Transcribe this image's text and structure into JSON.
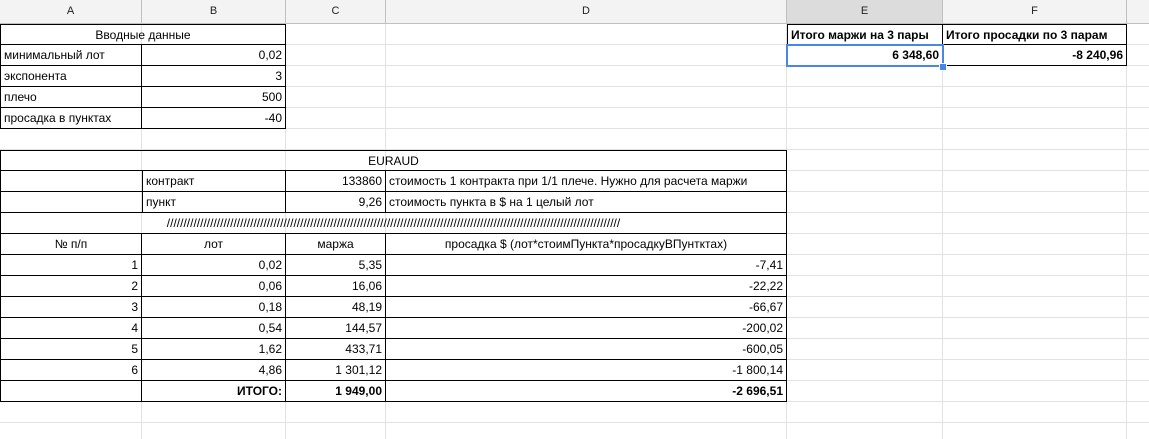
{
  "columns": [
    "A",
    "B",
    "C",
    "D",
    "E",
    "F"
  ],
  "selected_column": "E",
  "input_block": {
    "title": "Вводные данные",
    "rows": [
      {
        "label": "минимальный лот",
        "value": "0,02"
      },
      {
        "label": "экспонента",
        "value": "3"
      },
      {
        "label": "плечо",
        "value": "500"
      },
      {
        "label": "просадка в пунктах",
        "value": "-40"
      }
    ]
  },
  "summary": {
    "margin_header": "Итого маржи на 3 пары",
    "drawdown_header": "Итого просадки по 3 парам",
    "margin_value": "6 348,60",
    "drawdown_value": "-8 240,96"
  },
  "pair_block": {
    "title": "EURAUD",
    "contract_label": "контракт",
    "contract_value": "133860",
    "contract_note": "стоимость 1 контракта при 1/1 плече. Нужно для расчета маржи",
    "point_label": "пункт",
    "point_value": "9,26",
    "point_note": "стоимость пункта в $ на 1 целый лот",
    "separator": "////////////////////////////////////////////////////////////////////////////////////////////////////////////////////////////////////////",
    "headers": [
      "№ п/п",
      "лот",
      "маржа",
      "просадка $ (лот*стоимПункта*просадкуВПунтктах)"
    ],
    "rows": [
      {
        "n": "1",
        "lot": "0,02",
        "margin": "5,35",
        "drawdown": "-7,41"
      },
      {
        "n": "2",
        "lot": "0,06",
        "margin": "16,06",
        "drawdown": "-22,22"
      },
      {
        "n": "3",
        "lot": "0,18",
        "margin": "48,19",
        "drawdown": "-66,67"
      },
      {
        "n": "4",
        "lot": "0,54",
        "margin": "144,57",
        "drawdown": "-200,02"
      },
      {
        "n": "5",
        "lot": "1,62",
        "margin": "433,71",
        "drawdown": "-600,05"
      },
      {
        "n": "6",
        "lot": "4,86",
        "margin": "1 301,12",
        "drawdown": "-1 800,14"
      }
    ],
    "total_label": "ИТОГО:",
    "total_margin": "1 949,00",
    "total_drawdown": "-2 696,51"
  }
}
